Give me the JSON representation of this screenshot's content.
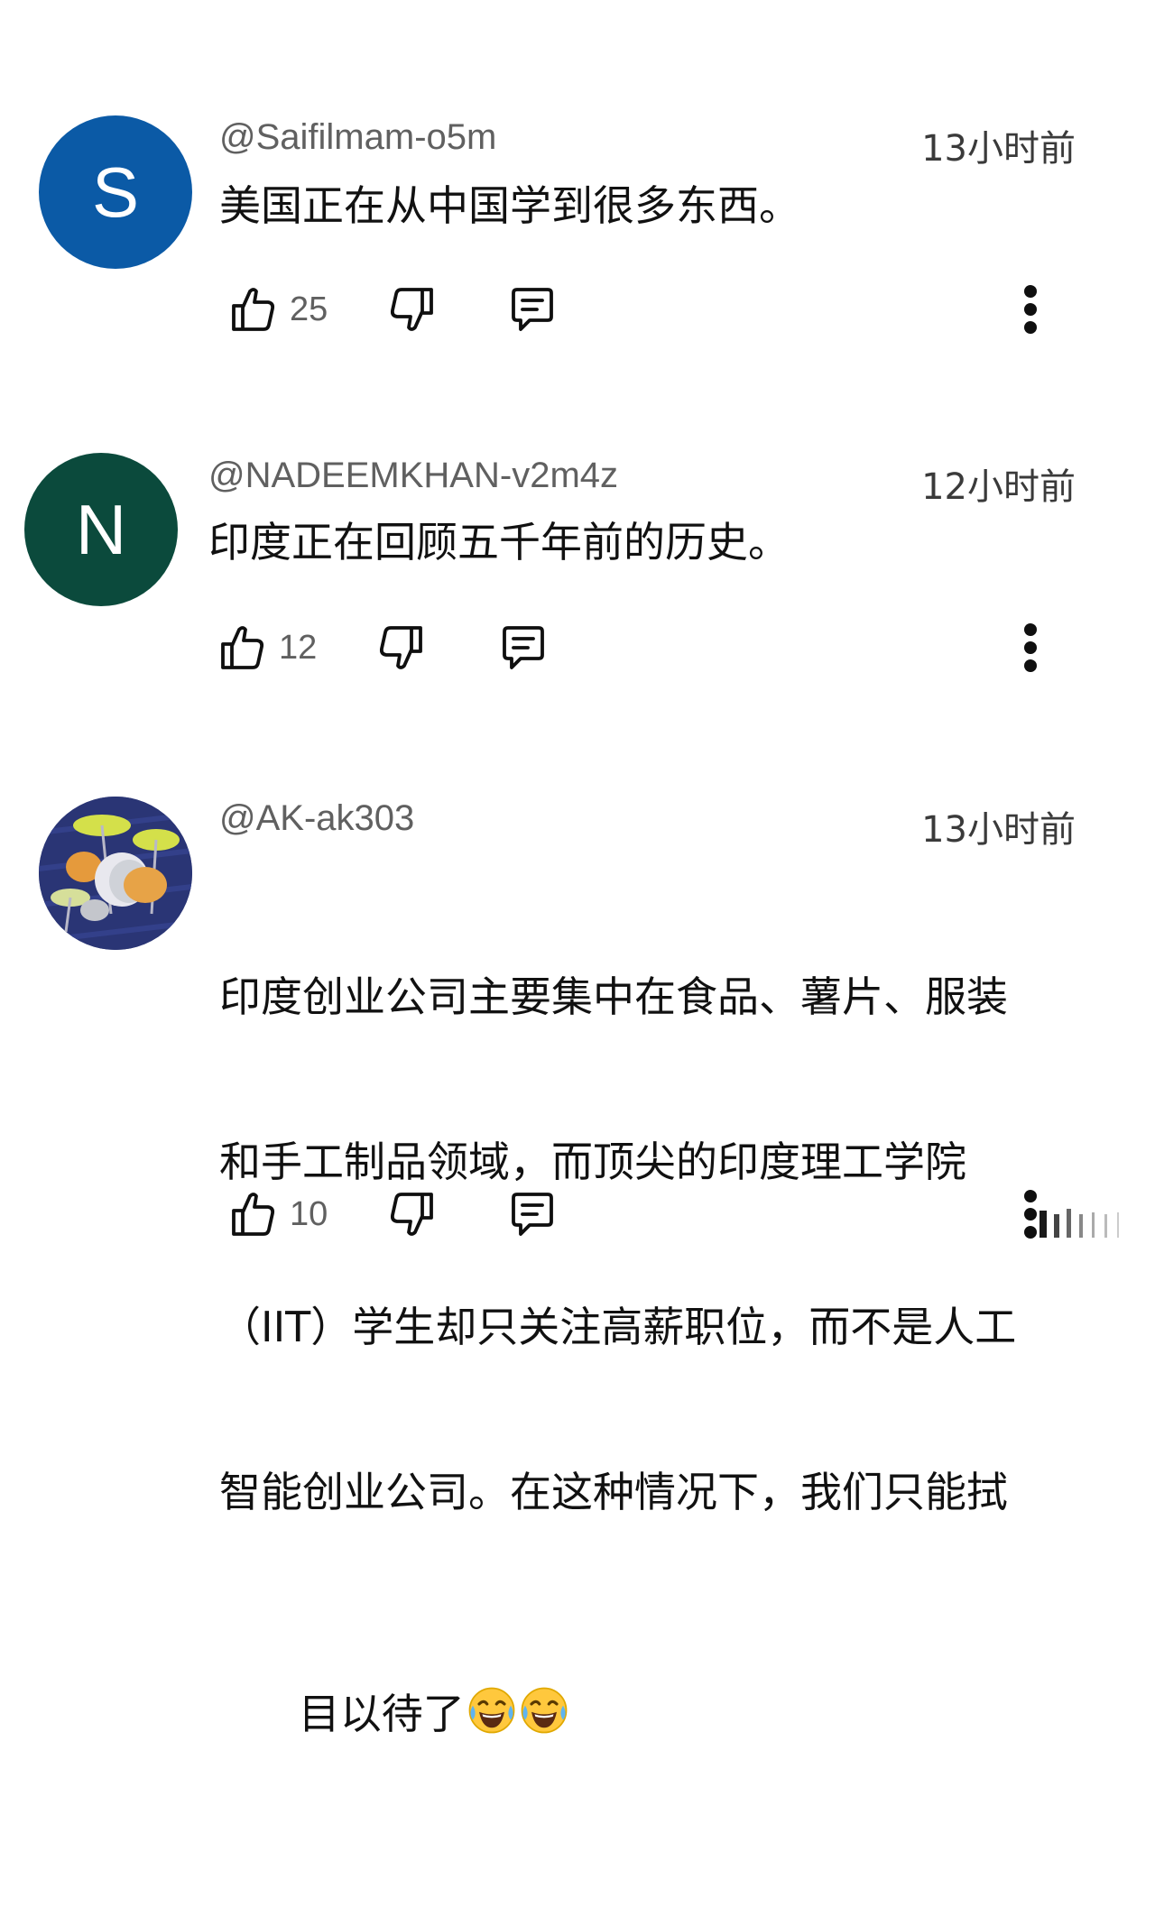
{
  "comments": [
    {
      "avatar_letter": "S",
      "avatar_color": "#0b5aa6",
      "handle": "@Saifilmam-o5m",
      "time": "13小时前",
      "text": "美国正在从中国学到很多东西。",
      "likes": "25"
    },
    {
      "avatar_letter": "N",
      "avatar_color": "#0b4a3c",
      "handle": "@NADEEMKHAN-v2m4z",
      "time": "12小时前",
      "text": "印度正在回顾五千年前的历史。",
      "likes": "12"
    },
    {
      "avatar_letter": "",
      "avatar_color": "#25306b",
      "handle": "@AK-ak303",
      "time": "13小时前",
      "text_lines": [
        "印度创业公司主要集中在食品、薯片、服装",
        "和手工制品领域，而顶尖的印度理工学院",
        "（IIT）学生却只关注高薪职位，而不是人工",
        "智能创业公司。在这种情况下，我们只能拭",
        "目以待了"
      ],
      "likes": "10"
    }
  ],
  "icons": {
    "like": "thumbs-up-icon",
    "dislike": "thumbs-down-icon",
    "reply": "reply-icon",
    "more": "more-vert-icon",
    "emoji": "face-with-tears-of-joy"
  }
}
